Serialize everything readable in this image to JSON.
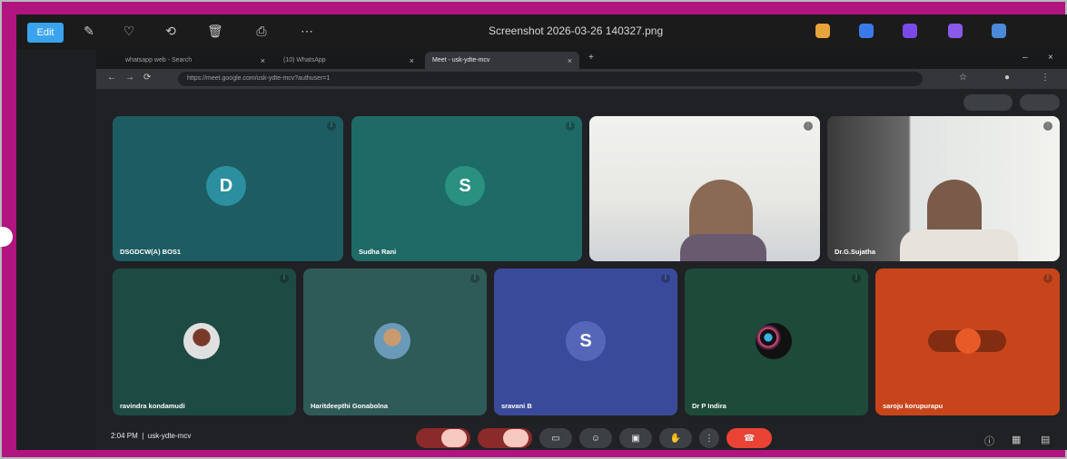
{
  "viewer": {
    "edit_label": "Edit",
    "title": "Screenshot 2026-03-26 140327.png"
  },
  "browser": {
    "tabs": [
      {
        "label": "whatsapp web - Search",
        "active": false
      },
      {
        "label": "(10) WhatsApp",
        "active": false
      },
      {
        "label": "Meet - usk-ydte-mcv",
        "active": true
      }
    ],
    "url": "https://meet.google.com/usk-ydte-mcv?authuser=1"
  },
  "meet": {
    "participants_row1": [
      {
        "name": "DSGDCW(A) BOS1",
        "initial": "D",
        "type": "avatar"
      },
      {
        "name": "Sudha Rani",
        "initial": "S",
        "type": "avatar"
      },
      {
        "name": "",
        "initial": "",
        "type": "video"
      },
      {
        "name": "Dr.G.Sujatha",
        "initial": "",
        "type": "video"
      }
    ],
    "participants_row2": [
      {
        "name": "ravindra kondamudi",
        "initial": "",
        "type": "photo"
      },
      {
        "name": "Haritdeepthi Gonabolna",
        "initial": "",
        "type": "photo"
      },
      {
        "name": "sravani B",
        "initial": "S",
        "type": "avatar"
      },
      {
        "name": "Dr P Indira",
        "initial": "",
        "type": "photo"
      },
      {
        "name": "saroju korupurapu",
        "initial": "",
        "type": "self"
      }
    ],
    "time": "2:04 PM",
    "meeting_code": "usk-ydte-mcv"
  },
  "colors": {
    "frame": "#b0147e",
    "tile_teal_1": "#1d5c62",
    "tile_teal_2": "#1e6a66",
    "tile_dark_green": "#1e4a44",
    "tile_blue": "#3a4a9a",
    "tile_orange": "#c8451c",
    "end_call": "#ea4335"
  }
}
